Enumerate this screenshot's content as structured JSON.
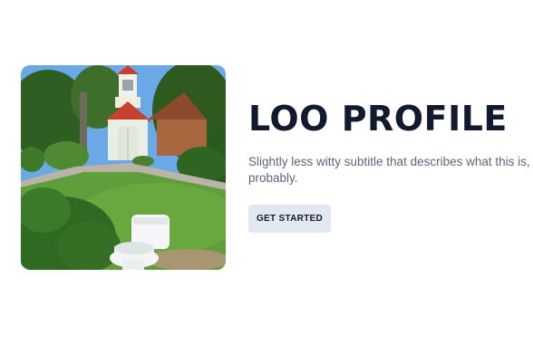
{
  "hero": {
    "title": "LOO PROFILE",
    "subtitle": "Slightly less witty subtitle that describes what this is, probably.",
    "cta_label": "GET STARTED"
  },
  "colors": {
    "title": "#111a2e",
    "subtitle": "#5b6678",
    "button_bg": "#e2e8f0"
  }
}
